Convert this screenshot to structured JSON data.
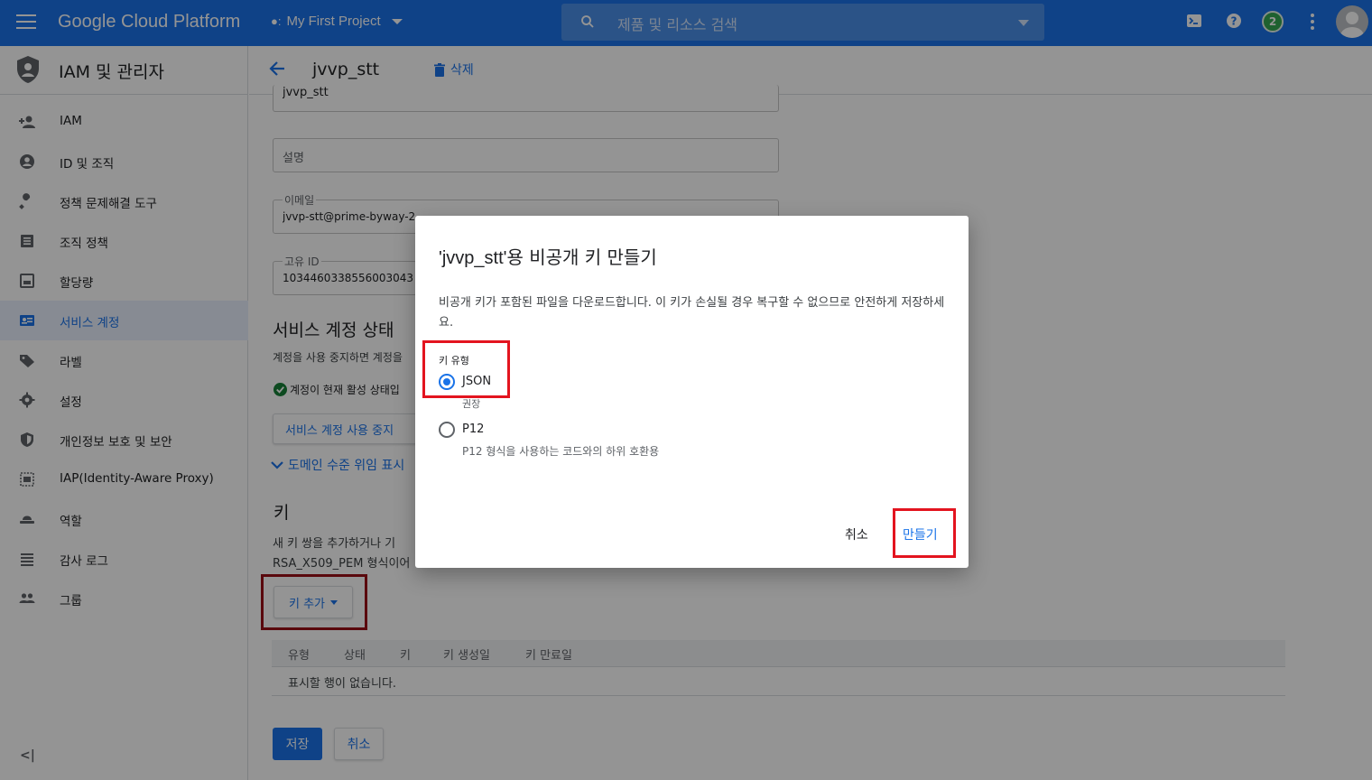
{
  "topbar": {
    "brand": "Google Cloud Platform",
    "project": "My First Project",
    "search_placeholder": "제품 및 리소스 검색",
    "notification_count": "2",
    "accent": "#1a73e8"
  },
  "sidebar": {
    "title": "IAM 및 관리자",
    "items": [
      {
        "label": "IAM",
        "icon": "person-add-icon"
      },
      {
        "label": "ID 및 조직",
        "icon": "account-circle-icon"
      },
      {
        "label": "정책 문제해결 도구",
        "icon": "wrench-icon"
      },
      {
        "label": "조직 정책",
        "icon": "list-icon"
      },
      {
        "label": "할당량",
        "icon": "quota-icon"
      },
      {
        "label": "서비스 계정",
        "icon": "service-account-icon"
      },
      {
        "label": "라벨",
        "icon": "tag-icon"
      },
      {
        "label": "설정",
        "icon": "gear-icon"
      },
      {
        "label": "개인정보 보호 및 보안",
        "icon": "shield-icon"
      },
      {
        "label": "IAP(Identity-Aware Proxy)",
        "icon": "proxy-icon"
      },
      {
        "label": "역할",
        "icon": "hat-icon"
      },
      {
        "label": "감사 로그",
        "icon": "lines-icon"
      },
      {
        "label": "그룹",
        "icon": "group-icon"
      }
    ],
    "active_index": 5,
    "collapse_label": "<|"
  },
  "main": {
    "title": "jvvp_stt",
    "delete_label": "삭제",
    "name_value": "jvvp_stt",
    "description_placeholder": "설명",
    "email_label": "이메일",
    "email_value": "jvvp-stt@prime-byway-2",
    "uid_label": "고유 ID",
    "uid_value": "1034460338556003043",
    "status_heading": "서비스 계정 상태",
    "status_desc": "계정을 사용 중지하면 계정을",
    "status_active": "계정이 현재 활성 상태입",
    "disable_button": "서비스 계정 사용 중지",
    "delegation_link": "도메인 수준 위임 표시",
    "keys_heading": "키",
    "keys_desc1": "새 키 쌍을 추가하거나 기",
    "keys_desc2": "RSA_X509_PEM 형식이어",
    "add_key_button": "키 추가",
    "table_headers": [
      "유형",
      "상태",
      "키",
      "키 생성일",
      "키 만료일"
    ],
    "table_empty": "표시할 행이 없습니다.",
    "save_button": "저장",
    "cancel_button": "취소"
  },
  "dialog": {
    "title_name": "'jvvp_stt'",
    "title_rest": "용 비공개 키 만들기",
    "desc": "비공개 키가 포함된 파일을 다운로드합니다. 이 키가 손실될 경우 복구할 수 없으므로 안전하게 저장하세요.",
    "key_type_label": "키 유형",
    "options": [
      {
        "label": "JSON",
        "sub": "권장",
        "checked": true
      },
      {
        "label": "P12",
        "sub": "P12 형식을 사용하는 코드와의 하위 호환용",
        "checked": false
      }
    ],
    "cancel": "취소",
    "create": "만들기"
  }
}
